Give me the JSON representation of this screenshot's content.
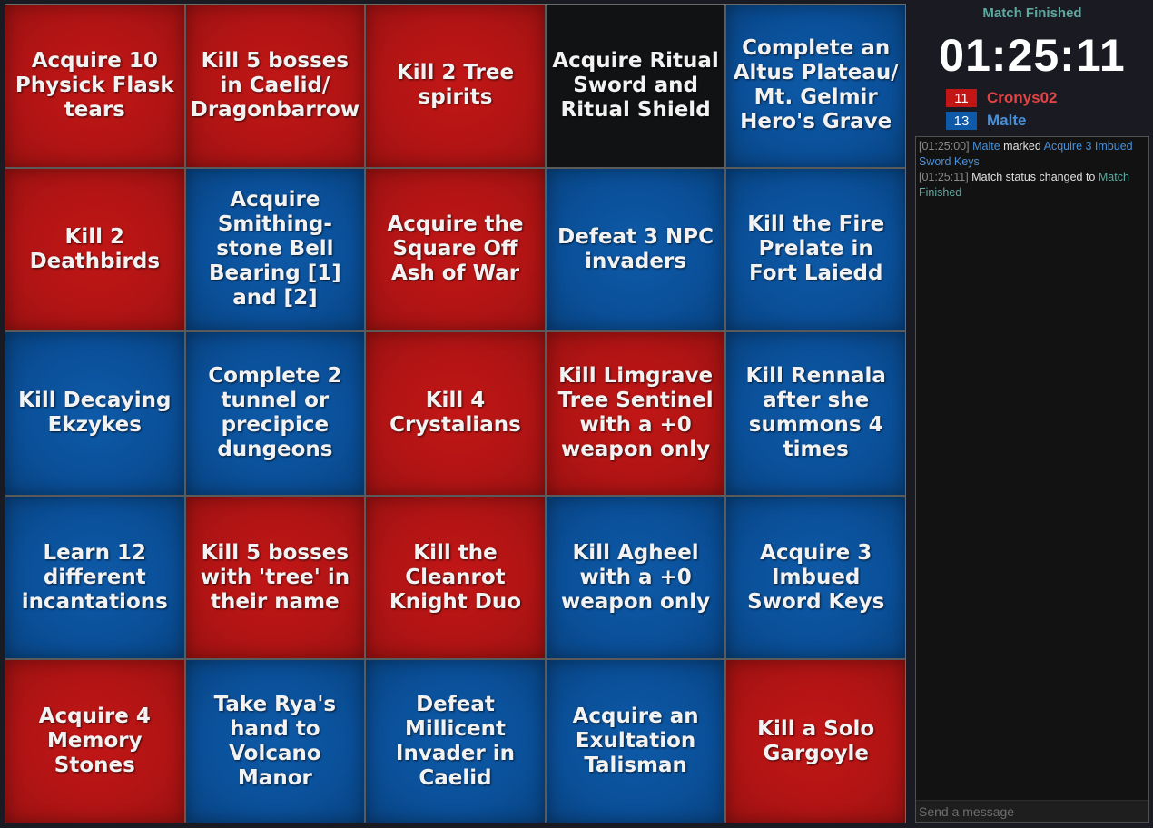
{
  "board": {
    "cells": [
      {
        "text": "Acquire 10 Physick Flask tears",
        "color": "red"
      },
      {
        "text": "Kill 5 bosses in Caelid/ Dragonbarrow",
        "color": "red"
      },
      {
        "text": "Kill 2 Tree spirits",
        "color": "red"
      },
      {
        "text": "Acquire Ritual Sword and Ritual Shield",
        "color": "black"
      },
      {
        "text": "Complete an Altus Plateau/ Mt. Gelmir Hero's Grave",
        "color": "blue"
      },
      {
        "text": "Kill 2 Deathbirds",
        "color": "red"
      },
      {
        "text": "Acquire Smithing-stone Bell Bearing [1] and [2]",
        "color": "blue"
      },
      {
        "text": "Acquire the Square Off Ash of War",
        "color": "red"
      },
      {
        "text": "Defeat 3 NPC invaders",
        "color": "blue"
      },
      {
        "text": "Kill the Fire Prelate in Fort Laiedd",
        "color": "blue"
      },
      {
        "text": "Kill Decaying Ekzykes",
        "color": "blue"
      },
      {
        "text": "Complete 2 tunnel or precipice dungeons",
        "color": "blue"
      },
      {
        "text": "Kill 4 Crystalians",
        "color": "red"
      },
      {
        "text": "Kill Limgrave Tree Sentinel with a +0 weapon only",
        "color": "red"
      },
      {
        "text": "Kill Rennala after she summons 4 times",
        "color": "blue"
      },
      {
        "text": "Learn 12 different incantations",
        "color": "blue"
      },
      {
        "text": "Kill 5 bosses with 'tree' in their name",
        "color": "red"
      },
      {
        "text": "Kill the Cleanrot Knight Duo",
        "color": "red"
      },
      {
        "text": "Kill Agheel with a +0 weapon only",
        "color": "blue"
      },
      {
        "text": "Acquire 3 Imbued Sword Keys",
        "color": "blue"
      },
      {
        "text": "Acquire 4 Memory Stones",
        "color": "red"
      },
      {
        "text": "Take Rya's hand to Volcano Manor",
        "color": "blue"
      },
      {
        "text": "Defeat Millicent Invader in Caelid",
        "color": "blue"
      },
      {
        "text": "Acquire an Exultation Talisman",
        "color": "blue"
      },
      {
        "text": "Kill a Solo Gargoyle",
        "color": "red"
      }
    ]
  },
  "sidebar": {
    "status": "Match Finished",
    "timer": "01:25:11",
    "players": [
      {
        "name": "Cronys02",
        "score": "11",
        "color": "#c21616"
      },
      {
        "name": "Malte",
        "score": "13",
        "color": "#0e5aa8"
      }
    ]
  },
  "chat": {
    "messages": [
      {
        "time": "[01:25:00]",
        "player": "Malte",
        "action": "marked",
        "goal": "Acquire 3 Imbued Sword Keys"
      },
      {
        "time": "[01:25:11]",
        "text": "Match status changed to",
        "status": "Match Finished"
      }
    ],
    "input_placeholder": "Send a message"
  }
}
